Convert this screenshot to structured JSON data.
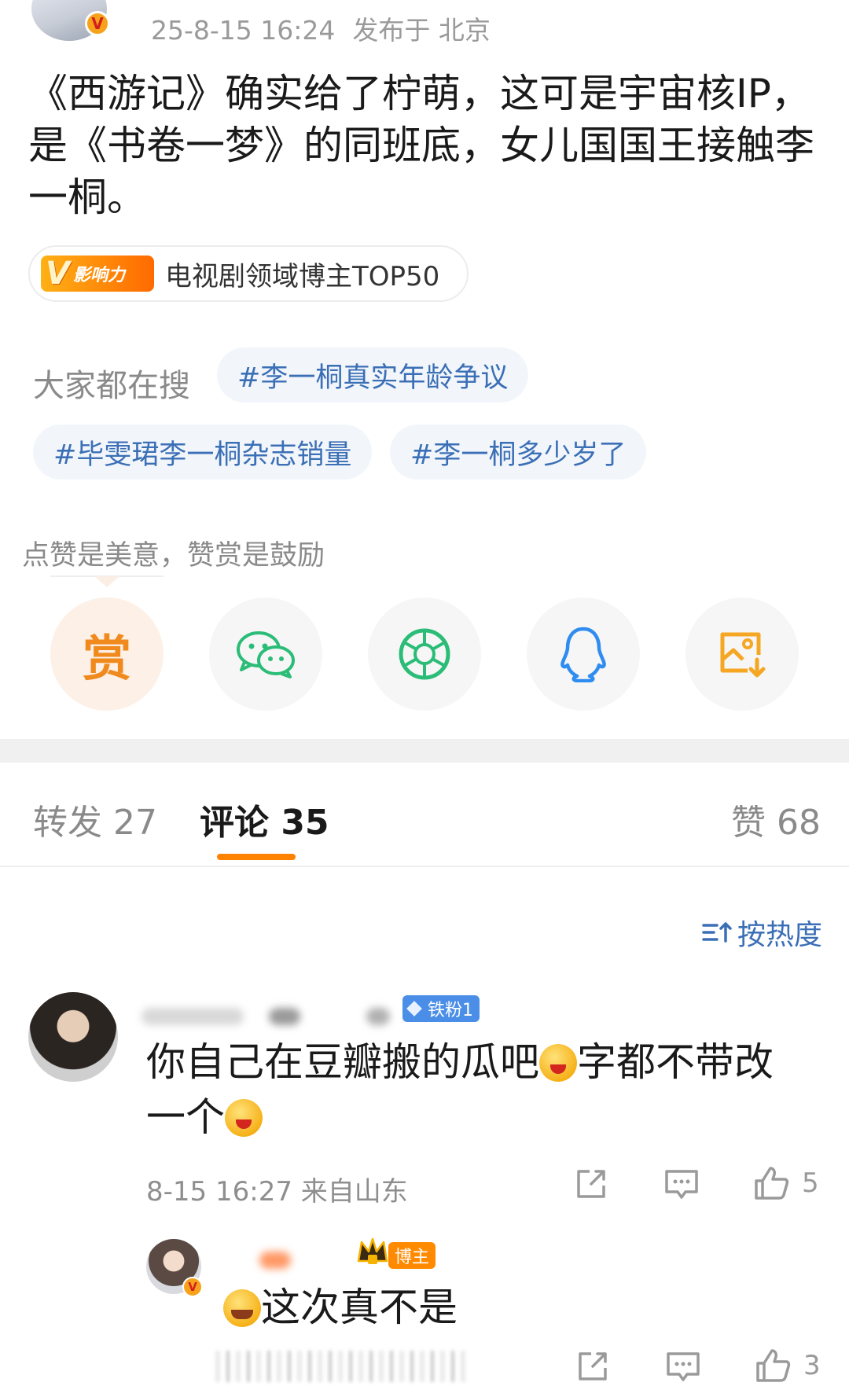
{
  "post": {
    "timestamp": "25-8-15 16:24",
    "location": "发布于 北京",
    "text": "《西游记》确实给了柠萌，这可是宇宙核IP，是《书卷一梦》的同班底，女儿国国王接触李一桐。",
    "badge_logo_v": "V",
    "badge_logo_text": "影响力",
    "badge_text": "电视剧领域博主TOP50"
  },
  "search": {
    "label": "大家都在搜",
    "tags": [
      "#李一桐真实年龄争议",
      "#毕雯珺李一桐杂志销量",
      "#李一桐多少岁了"
    ]
  },
  "reward": {
    "text": "点赞是美意，赞赏是鼓励",
    "reward_button": "赏"
  },
  "share_buttons": [
    {
      "icon": "reward-icon"
    },
    {
      "icon": "wechat-icon"
    },
    {
      "icon": "moments-icon"
    },
    {
      "icon": "qq-icon"
    },
    {
      "icon": "save-image-icon"
    }
  ],
  "tabs": {
    "repost": "转发 27",
    "comments": "评论 35",
    "likes": "赞 68"
  },
  "sort": {
    "label": "按热度"
  },
  "comments": [
    {
      "fan_badge": "铁粉1",
      "text_part1": "你自己在豆瓣搬的瓜吧",
      "text_part2": "字都不带改一个",
      "meta": "8-15 16:27 来自山东",
      "like_count": "5"
    },
    {
      "blogger_badge": "博主",
      "text": "这次真不是",
      "like_count": "3"
    }
  ],
  "colors": {
    "accent": "#ff8200",
    "link": "#3b6fb6",
    "muted": "#8a8a8a"
  }
}
